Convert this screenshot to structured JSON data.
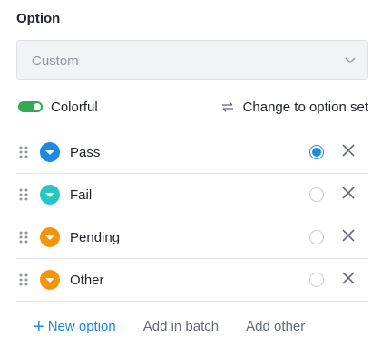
{
  "section": {
    "title": "Option"
  },
  "select": {
    "value": "Custom",
    "icon": "chevron-down-icon"
  },
  "colorful": {
    "label": "Colorful",
    "enabled": true,
    "color": "#34a853"
  },
  "change": {
    "label": "Change to option set",
    "icon": "swap-arrows-icon"
  },
  "options": [
    {
      "name": "Pass",
      "color": "#1e88e5",
      "selected": true
    },
    {
      "name": "Fail",
      "color": "#26c6c6",
      "selected": false
    },
    {
      "name": "Pending",
      "color": "#f5930b",
      "selected": false
    },
    {
      "name": "Other",
      "color": "#f5930b",
      "selected": false
    }
  ],
  "footer": {
    "new_option": "New option",
    "add_batch": "Add in batch",
    "add_other": "Add other"
  },
  "colors": {
    "accent": "#1e88e5",
    "divider": "#e8e9eb"
  }
}
